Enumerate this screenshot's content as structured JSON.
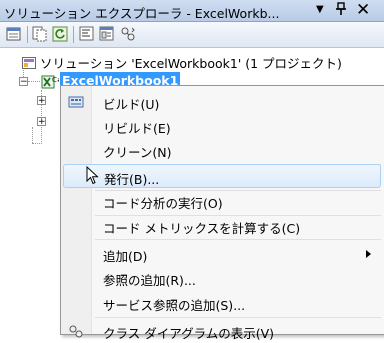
{
  "window": {
    "title": "ソリューション エクスプローラ - ExcelWorkb...",
    "dropdown_glyph": "▼",
    "pin_glyph": "Ҍ",
    "close_glyph": "✕"
  },
  "tree": {
    "solution_label": "ソリューション 'ExcelWorkbook1' (1 プロジェクト)",
    "project_label": "ExcelWorkbook1"
  },
  "context_menu": {
    "items": [
      {
        "label": "ビルド(U)"
      },
      {
        "label": "リビルド(E)"
      },
      {
        "label": "クリーン(N)"
      },
      {
        "label": "発行(B)..."
      },
      {
        "label": "コード分析の実行(O)"
      },
      {
        "label": "コード メトリックスを計算する(C)"
      },
      {
        "label": "追加(D)"
      },
      {
        "label": "参照の追加(R)..."
      },
      {
        "label": "サービス参照の追加(S)..."
      },
      {
        "label": "クラス ダイアグラムの表示(V)"
      }
    ],
    "highlighted_item": "発行(B)..."
  }
}
